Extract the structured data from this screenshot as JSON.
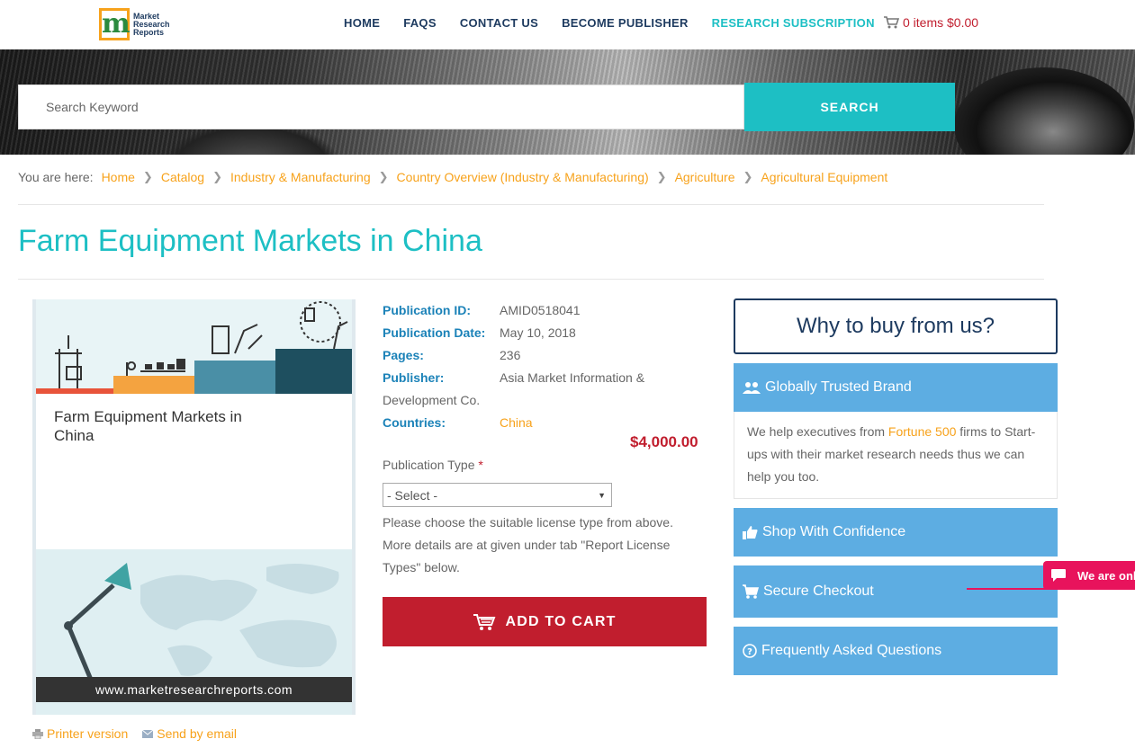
{
  "header": {
    "logo_text": [
      "Market",
      "Research",
      "Reports"
    ],
    "nav": [
      {
        "label": "HOME",
        "accent": false
      },
      {
        "label": "FAQS",
        "accent": false
      },
      {
        "label": "CONTACT US",
        "accent": false
      },
      {
        "label": "BECOME PUBLISHER",
        "accent": false
      },
      {
        "label": "RESEARCH SUBSCRIPTION",
        "accent": true
      }
    ],
    "cart_label": "0 items $0.00"
  },
  "search": {
    "placeholder": "Search Keyword",
    "button_label": "SEARCH"
  },
  "breadcrumb": {
    "lead": "You are here:",
    "items": [
      "Home",
      "Catalog",
      "Industry & Manufacturing",
      "Country Overview (Industry & Manufacturing)",
      "Agriculture",
      "Agricultural Equipment"
    ]
  },
  "page_title": "Farm Equipment Markets in China",
  "cover": {
    "title": "Farm Equipment Markets in China",
    "url": "www.marketresearchreports.com"
  },
  "cover_links": {
    "printer": "Printer version",
    "email": "Send by email"
  },
  "details": {
    "publication_id_label": "Publication ID:",
    "publication_id": "AMID0518041",
    "publication_date_label": "Publication Date:",
    "publication_date": "May 10, 2018",
    "pages_label": "Pages:",
    "pages": "236",
    "publisher_label": "Publisher:",
    "publisher_line1": "Asia Market Information &",
    "publisher_line2": "Development Co.",
    "countries_label": "Countries:",
    "countries": "China",
    "price": "$4,000.00",
    "publication_type_label": "Publication Type",
    "required_mark": "*",
    "select_value": "- Select -",
    "help_text": "Please choose the suitable license type from above. More details are at given under tab \"Report License Types\" below.",
    "add_to_cart": "ADD TO CART"
  },
  "sidebar": {
    "why_title": "Why to buy from us?",
    "trusted_title": "Globally Trusted Brand",
    "trusted_body_before": "We help executives from ",
    "trusted_body_highlight": "Fortune 500",
    "trusted_body_after": " firms to Start-ups with their market research needs thus we can help you too.",
    "shop_title": "Shop With Confidence",
    "secure_title": "Secure Checkout",
    "faq_title": "Frequently Asked Questions"
  },
  "chat": {
    "label": "We are online"
  },
  "colors": {
    "teal": "#1dbfc4",
    "navy": "#1d3a5f",
    "orange": "#f7a21b",
    "red": "#c11e2e",
    "panel_blue": "#5dade2",
    "chat_pink": "#e8135c"
  }
}
